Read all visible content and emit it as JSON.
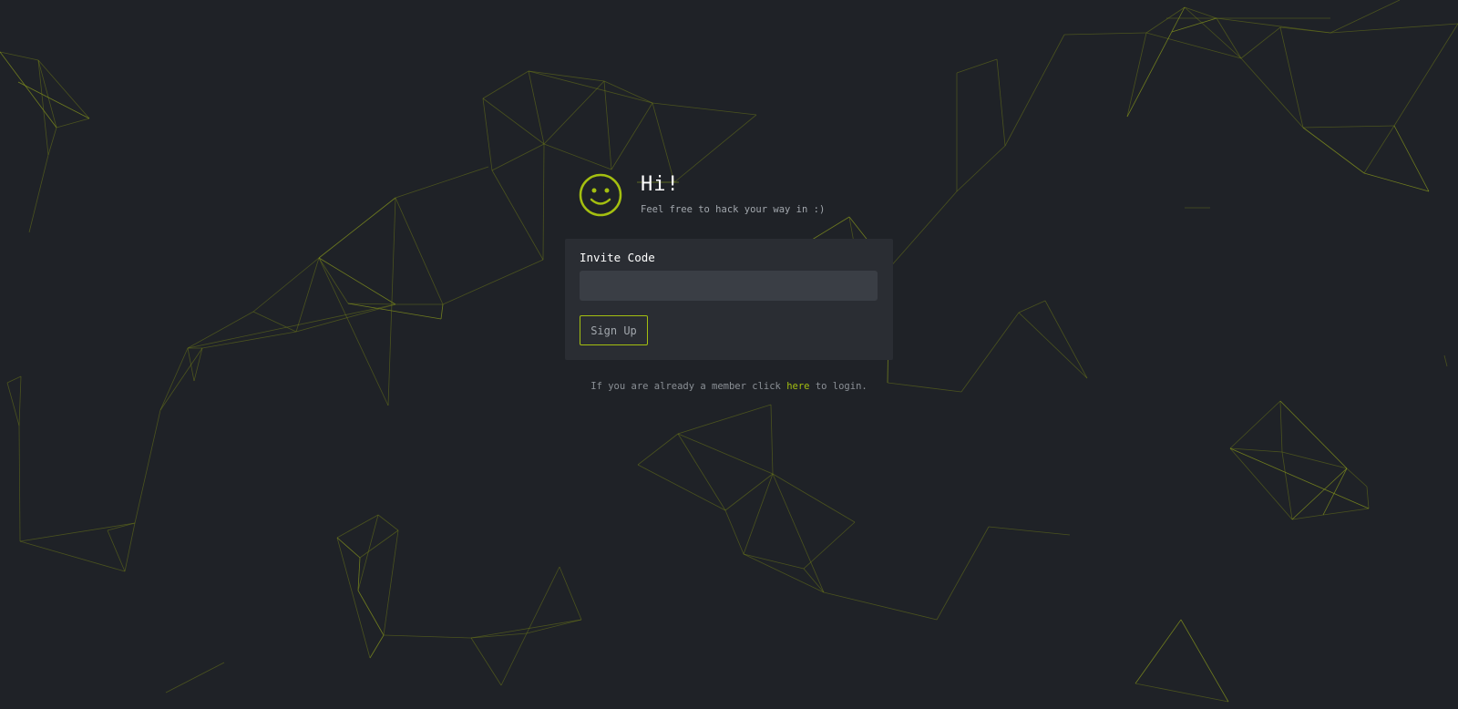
{
  "header": {
    "title": "Hi!",
    "subtitle": "Feel free to hack your way in :)"
  },
  "form": {
    "invite_label": "Invite Code",
    "invite_value": "",
    "invite_placeholder": "",
    "submit_label": "Sign Up"
  },
  "footer": {
    "prefix": "If you are already a member click ",
    "link_label": "here",
    "suffix": " to login."
  },
  "colors": {
    "background": "#1f2227",
    "card": "#2a2d33",
    "input": "#3a3e45",
    "accent": "#a4bf10",
    "network_lines": "#6e7a18"
  },
  "icons": {
    "logo": "smiley-face-icon"
  }
}
